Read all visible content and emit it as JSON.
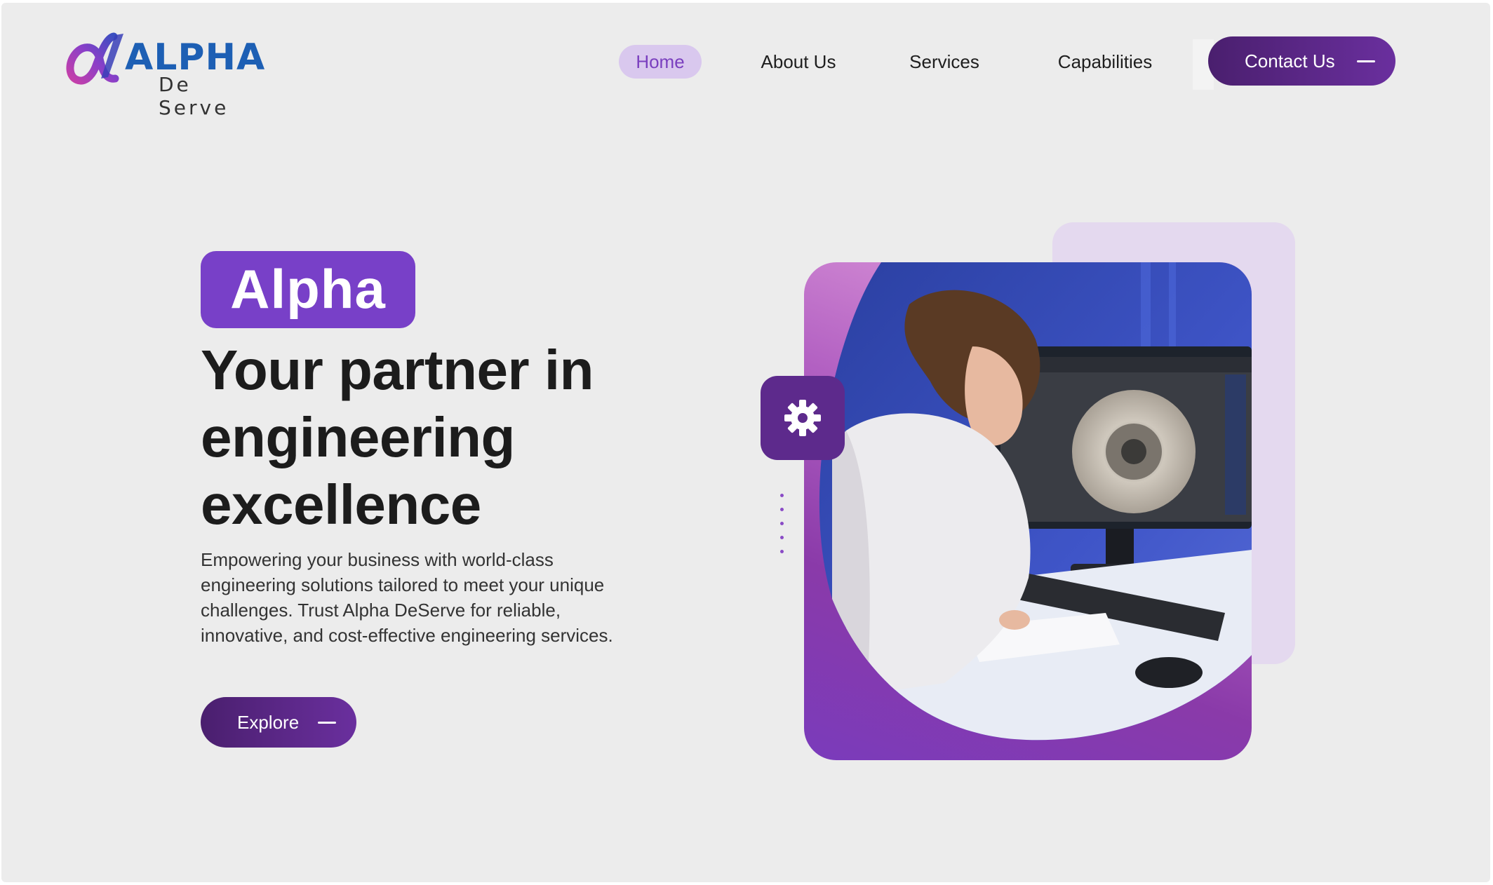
{
  "brand": {
    "name": "ALPHA",
    "tagline": "De Serve"
  },
  "nav": {
    "items": [
      {
        "label": "Home",
        "active": true
      },
      {
        "label": "About Us"
      },
      {
        "label": "Services"
      },
      {
        "label": "Capabilities"
      }
    ],
    "contact_label": "Contact Us"
  },
  "hero": {
    "badge": "Alpha",
    "headline_lines": [
      "Your partner in",
      "engineering",
      "excellence"
    ],
    "description": "Empowering your business with world-class engineering solutions tailored to meet your unique challenges. Trust Alpha DeServe for reliable, innovative, and cost-effective engineering services.",
    "cta_label": "Explore"
  },
  "image": {
    "subject": "engineer-at-cad-workstation",
    "icon": "gear-icon"
  },
  "colors": {
    "background": "#ececec",
    "brand_purple": "#7840c8",
    "button_dark": "#4a1f6e",
    "nav_active_bg": "#d9c8ee",
    "nav_active_text": "#7a3fbf",
    "logo_blue": "#1d5fb4",
    "heading": "#1c1c1c"
  }
}
